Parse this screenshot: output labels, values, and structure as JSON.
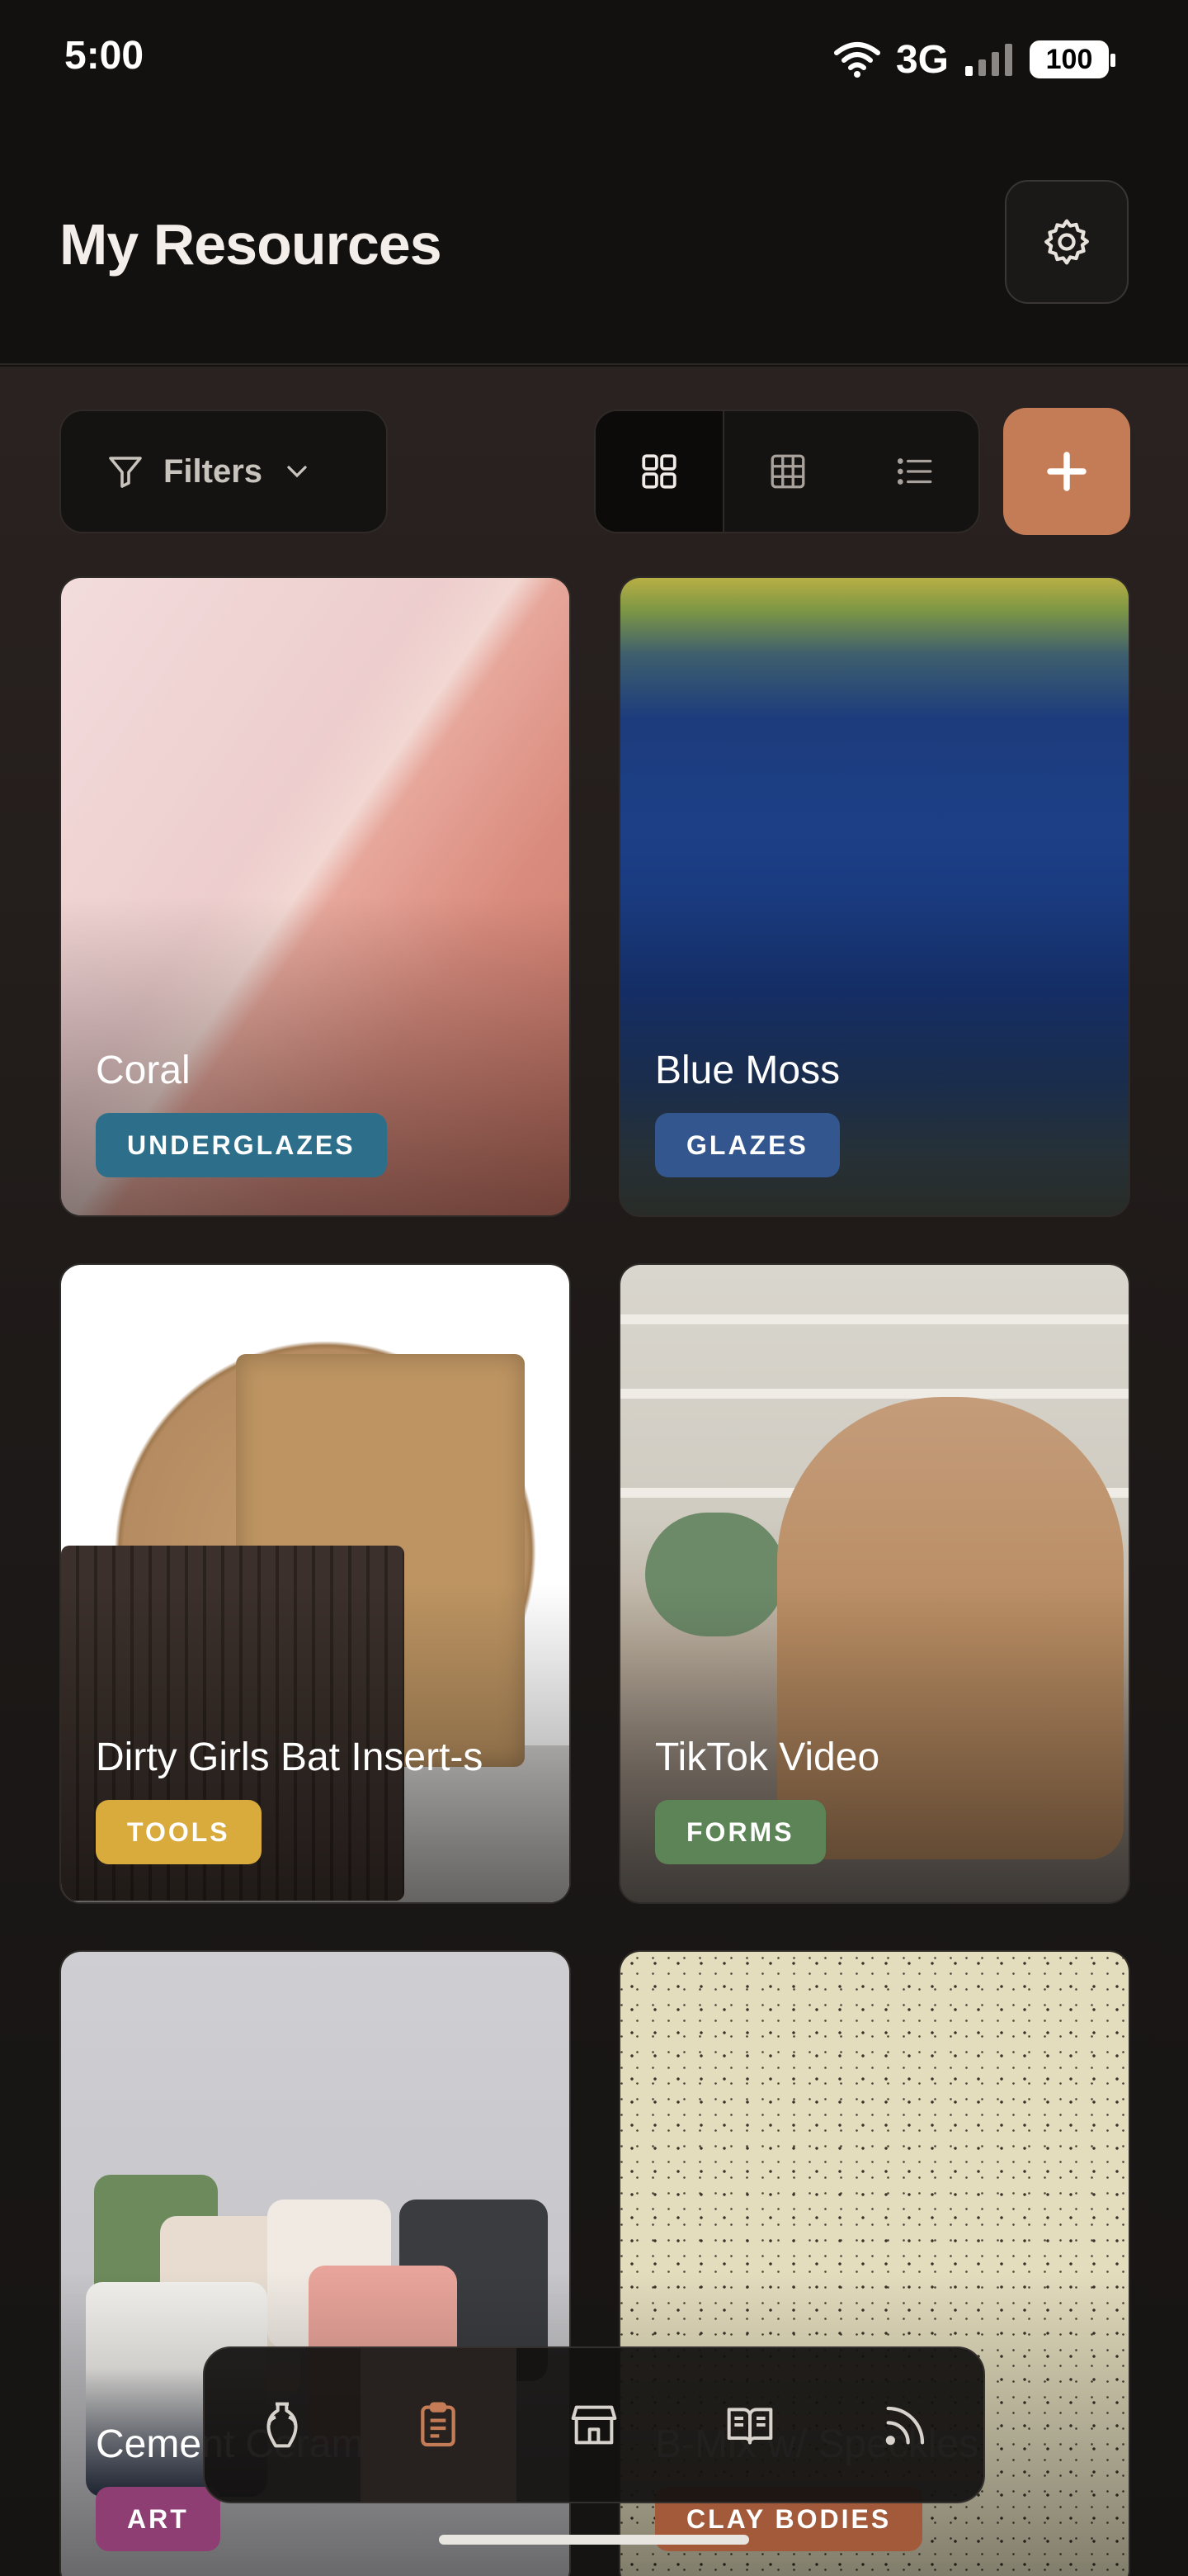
{
  "status": {
    "time": "5:00",
    "network": "3G",
    "battery": "100"
  },
  "header": {
    "title": "My Resources",
    "settings_icon": "gear-icon"
  },
  "toolbar": {
    "filters_label": "Filters",
    "view_options": [
      "large-grid",
      "small-grid",
      "list"
    ],
    "active_view": "large-grid",
    "add_icon": "plus-icon",
    "accent": "#c47c56"
  },
  "resources": [
    {
      "title": "Coral",
      "tag": "UNDERGLAZES",
      "tag_color": "#2d6f8a"
    },
    {
      "title": "Blue Moss",
      "tag": "GLAZES",
      "tag_color": "#33568f"
    },
    {
      "title": "Dirty Girls Bat Insert-s",
      "tag": "TOOLS",
      "tag_color": "#d9aa3c"
    },
    {
      "title": "TikTok Video",
      "tag": "FORMS",
      "tag_color": "#5c8457"
    },
    {
      "title": "Cement Ceramic",
      "tag": "ART",
      "tag_color": "#8f3e74"
    },
    {
      "title": "B-Mix w/ Speckles",
      "tag": "CLAY BODIES",
      "tag_color": "#a25a3a"
    }
  ],
  "bottom_nav": {
    "items": [
      "vase-icon",
      "clipboard-icon",
      "store-icon",
      "book-icon",
      "feed-icon"
    ],
    "active": "clipboard-icon"
  }
}
